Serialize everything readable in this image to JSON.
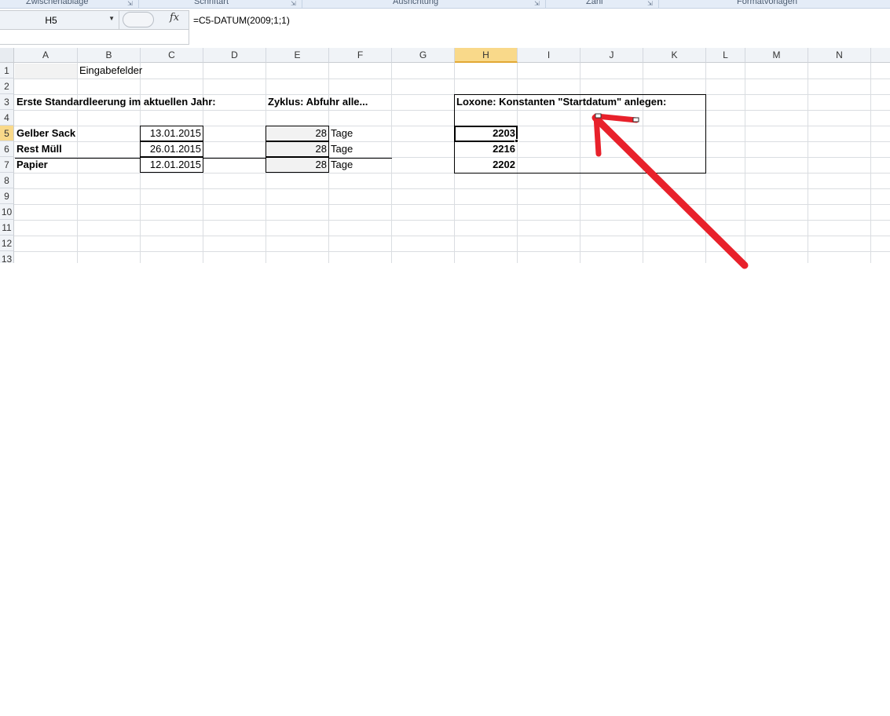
{
  "ribbon": {
    "groups": [
      "Zwischenablage",
      "Schriftart",
      "Ausrichtung",
      "Zahl",
      "Formatvorlagen"
    ]
  },
  "formula_bar": {
    "name_box": "H5",
    "fx_label": "fx",
    "formula": "=C5-DATUM(2009;1;1)"
  },
  "sheet": {
    "columns": [
      "A",
      "B",
      "C",
      "D",
      "E",
      "F",
      "G",
      "H",
      "I",
      "J",
      "K",
      "L",
      "M",
      "N"
    ],
    "selected_column": "H",
    "rows": [
      "1",
      "2",
      "3",
      "4",
      "5",
      "6",
      "7",
      "8",
      "9",
      "10",
      "11",
      "12",
      "13"
    ],
    "selected_row": "5",
    "cells": {
      "B1": "Eingabefelder",
      "A3": "Erste Standardleerung im aktuellen Jahr:",
      "E3": "Zyklus: Abfuhr alle...",
      "H3": "Loxone: Konstanten \"Startdatum\" anlegen:",
      "A5": "Gelber Sack",
      "A6": "Rest Müll",
      "A7": "Papier",
      "C5": "13.01.2015",
      "C6": "26.01.2015",
      "C7": "12.01.2015",
      "E5": "28",
      "E6": "28",
      "E7": "28",
      "F5": "Tage",
      "F6": "Tage",
      "F7": "Tage",
      "H5": "2203",
      "H6": "2216",
      "H7": "2202"
    }
  },
  "colors": {
    "header_selected": "#f9d98a",
    "annotation_red": "#e8212b",
    "input_fill": "#f2f2f2"
  }
}
